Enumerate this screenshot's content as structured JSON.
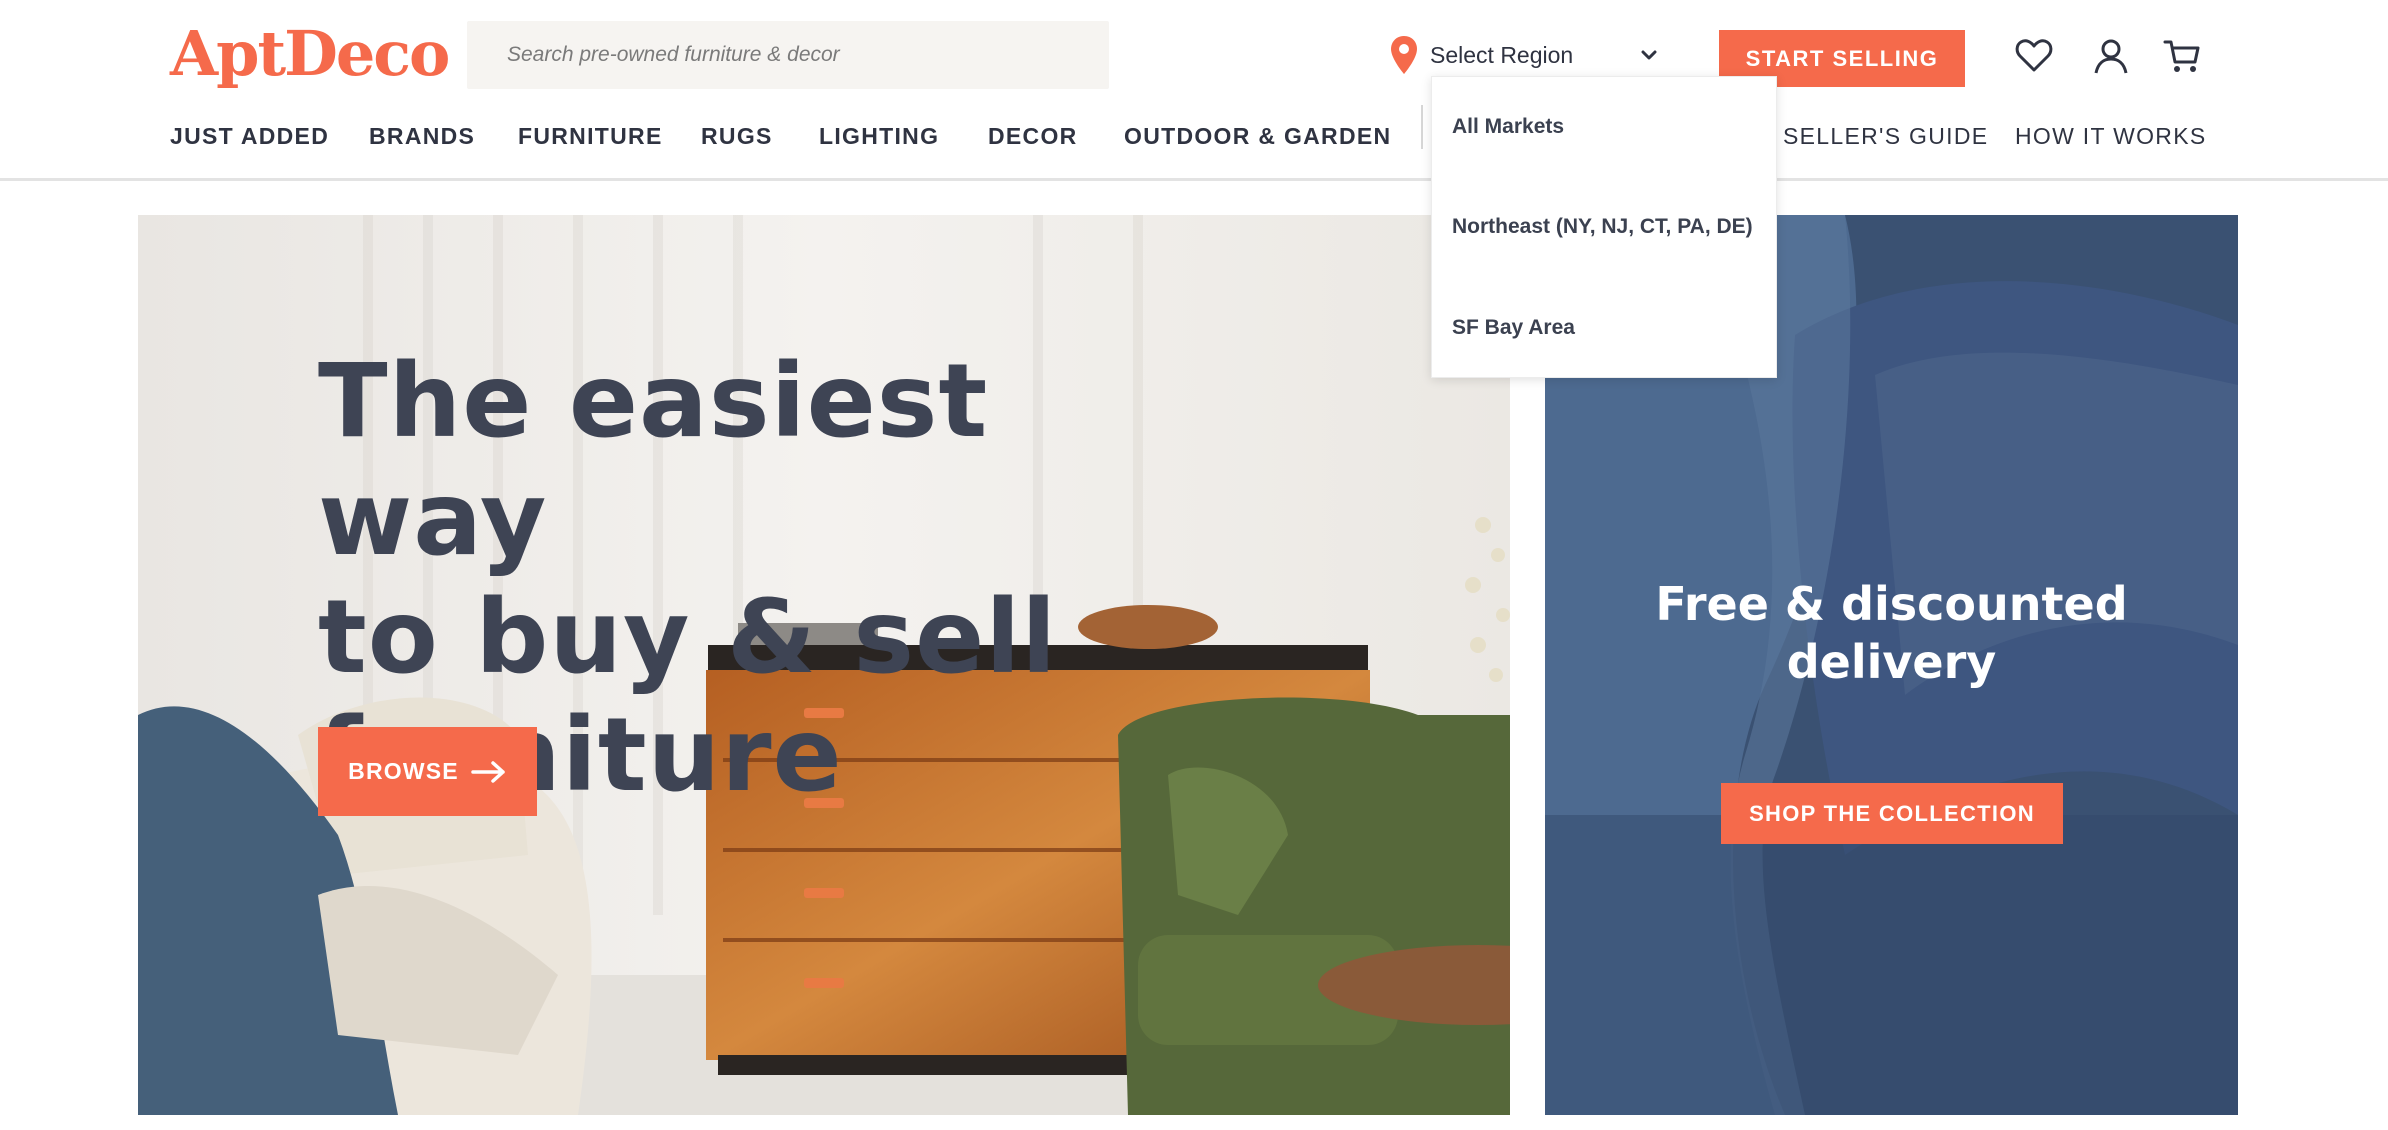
{
  "header": {
    "logo_text": "AptDeco",
    "search": {
      "placeholder": "Search pre-owned furniture & decor"
    },
    "region": {
      "label": "Select Region",
      "icon": "map-pin-icon"
    },
    "start_selling_label": "START SELLING",
    "icons": [
      "heart-icon",
      "user-icon",
      "cart-icon"
    ]
  },
  "nav": {
    "items": [
      {
        "label": "JUST ADDED"
      },
      {
        "label": "BRANDS"
      },
      {
        "label": "FURNITURE"
      },
      {
        "label": "RUGS"
      },
      {
        "label": "LIGHTING"
      },
      {
        "label": "DECOR"
      },
      {
        "label": "OUTDOOR & GARDEN"
      },
      {
        "label": "SELLER'S GUIDE"
      },
      {
        "label": "HOW IT WORKS"
      }
    ]
  },
  "region_dropdown": {
    "options": [
      {
        "label": "All Markets"
      },
      {
        "label": "Northeast (NY, NJ, CT, PA, DE)"
      },
      {
        "label": "SF Bay Area"
      }
    ]
  },
  "hero": {
    "title_lines": [
      "The easiest way",
      "to buy & sell",
      "furniture"
    ],
    "browse_label": "BROWSE"
  },
  "promo": {
    "title_lines": [
      "Free & discounted",
      "delivery"
    ],
    "button_label": "SHOP THE COLLECTION"
  },
  "colors": {
    "accent": "#f56a4b",
    "text_dark": "#3e4454",
    "promo_bg": "#3d5476"
  }
}
